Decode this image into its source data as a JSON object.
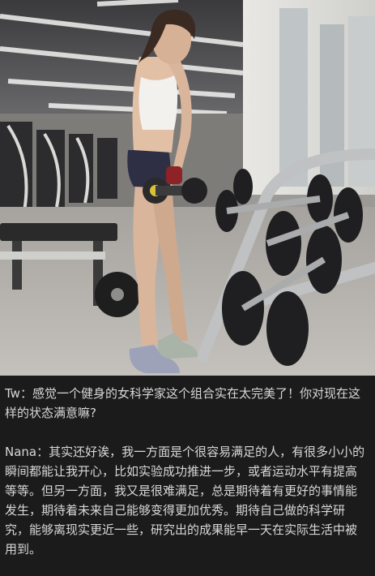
{
  "article": {
    "photo_alt": "gym-photo",
    "question": "Tw：感觉一个健身的女科学家这个组合实在太完美了！你对现在这样的状态满意嘛?",
    "answer": "Nana：其实还好诶，我一方面是个很容易满足的人，有很多小小的瞬间都能让我开心，比如实验成功推进一步，或者运动水平有提高等等。但另一方面，我又是很难满足，总是期待着有更好的事情能发生，期待着未来自己能够变得更加优秀。期待自己做的科学研究，能够离现实更近一些，研究出的成果能早一天在实际生活中被用到。"
  },
  "colors": {
    "background": "#1b1b1b",
    "text": "#d8d8d8"
  }
}
